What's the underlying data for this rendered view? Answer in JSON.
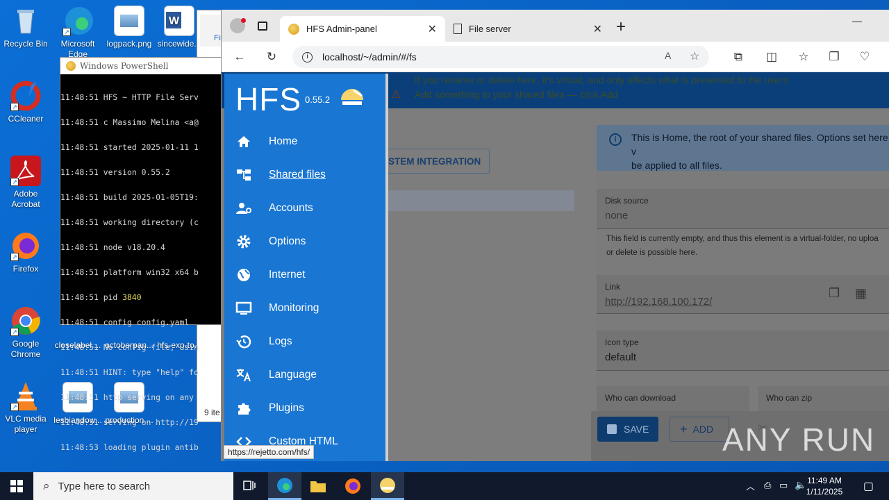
{
  "desktop": {
    "icons": [
      {
        "label": "Recycle Bin",
        "name": "recycle-bin-icon"
      },
      {
        "label": "CCleaner",
        "name": "ccleaner-icon"
      },
      {
        "label": "Adobe Acrobat",
        "name": "adobe-acrobat-icon"
      },
      {
        "label": "Firefox",
        "name": "firefox-icon"
      },
      {
        "label": "Google Chrome",
        "name": "chrome-icon"
      },
      {
        "label": "VLC media player",
        "name": "vlc-icon"
      },
      {
        "label": "Microsoft Edge",
        "name": "edge-icon"
      },
      {
        "label": "logpack.png",
        "name": "image-file-icon"
      },
      {
        "label": "sincewide...",
        "name": "word-file-icon"
      },
      {
        "label": "closelabel....",
        "name": "image-file-icon"
      },
      {
        "label": "octoberpan...",
        "name": "word-file-icon"
      },
      {
        "label": "hfs-exp-to...",
        "name": "word-file-icon"
      },
      {
        "label": "lesbiandow...",
        "name": "image-file-icon"
      },
      {
        "label": "production....",
        "name": "image-file-icon"
      }
    ]
  },
  "powershell": {
    "title": "Windows PowerShell",
    "lines": [
      "11:48:51 HFS ~ HTTP File Serv",
      "11:48:51 c Massimo Melina <a@",
      "11:48:51 started 2025-01-11 1",
      "11:48:51 version 0.55.2",
      "11:48:51 build 2025-01-05T19:",
      "11:48:51 working directory (c",
      "11:48:51 node v18.20.4",
      "11:48:51 platform win32 x64 b",
      "11:48:51 pid ",
      "11:48:51 config config.yaml",
      "11:48:51 No config file, usin",
      "11:48:51 HINT: type \"help\" fo",
      "11:48:51 http serving on any",
      "11:48:51 serving on http://19",
      "11:48:53 loading plugin antib"
    ],
    "pid": "3840"
  },
  "explorer": {
    "tab_label": "File",
    "item_count": "9 ite"
  },
  "browser": {
    "tabs": [
      {
        "label": "HFS Admin-panel",
        "active": true
      },
      {
        "label": "File server",
        "active": false
      }
    ],
    "url": "localhost/~/admin/#/fs",
    "status_url": "https://rejetto.com/hfs/"
  },
  "hfs": {
    "logo": "HFS",
    "version": "0.55.2",
    "banner_line1": "If you rename or delete here, it's virtual, and only affects what is presented to the users",
    "banner_line2": "Add something to your shared files — click Add",
    "system_integration": "YSTEM INTEGRATION",
    "nav": [
      {
        "label": "Home",
        "icon": "home-icon"
      },
      {
        "label": "Shared files",
        "icon": "folder-tree-icon",
        "selected": true
      },
      {
        "label": "Accounts",
        "icon": "accounts-icon"
      },
      {
        "label": "Options",
        "icon": "gear-icon"
      },
      {
        "label": "Internet",
        "icon": "globe-icon"
      },
      {
        "label": "Monitoring",
        "icon": "monitor-icon"
      },
      {
        "label": "Logs",
        "icon": "history-icon"
      },
      {
        "label": "Language",
        "icon": "translate-icon"
      },
      {
        "label": "Plugins",
        "icon": "puzzle-icon"
      },
      {
        "label": "Custom HTML",
        "icon": "code-icon"
      }
    ],
    "info_text_1": "This is Home, the root of your shared files. Options set here v",
    "info_text_2": "be applied to all files.",
    "disk_source_label": "Disk source",
    "disk_source_value": "none",
    "disk_note_1": "This field is currently empty, and thus this element is a virtual-folder, no uploa",
    "disk_note_2": "or delete is possible here.",
    "link_label": "Link",
    "link_value": "http://192.168.100.172/",
    "icon_type_label": "Icon type",
    "icon_type_value": "default",
    "who_download_label": "Who can download",
    "who_zip_label": "Who can zip",
    "save_label": "SAVE",
    "add_label": "ADD"
  },
  "taskbar": {
    "search_placeholder": "Type here to search",
    "time": "11:49 AM",
    "date": "1/11/2025"
  },
  "watermark": "ANY RUN"
}
